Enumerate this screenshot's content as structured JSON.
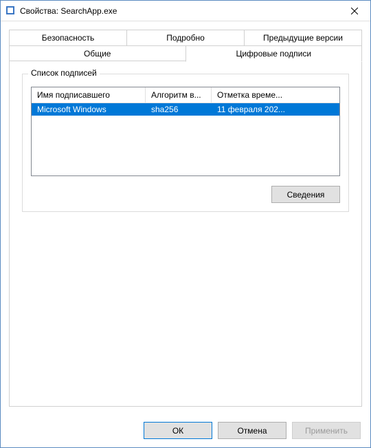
{
  "window": {
    "title": "Свойства: SearchApp.exe"
  },
  "tabs": {
    "row1": [
      "Безопасность",
      "Подробно",
      "Предыдущие версии"
    ],
    "row2": [
      "Общие",
      "Цифровые подписи"
    ],
    "active": "Цифровые подписи"
  },
  "group": {
    "title": "Список подписей"
  },
  "list": {
    "columns": [
      "Имя подписавшего",
      "Алгоритм в...",
      "Отметка време..."
    ],
    "rows": [
      {
        "signer": "Microsoft Windows",
        "digest": "sha256",
        "timestamp": "11 февраля 202..."
      }
    ],
    "selected_index": 0
  },
  "buttons": {
    "details": "Сведения",
    "ok": "ОК",
    "cancel": "Отмена",
    "apply": "Применить"
  }
}
